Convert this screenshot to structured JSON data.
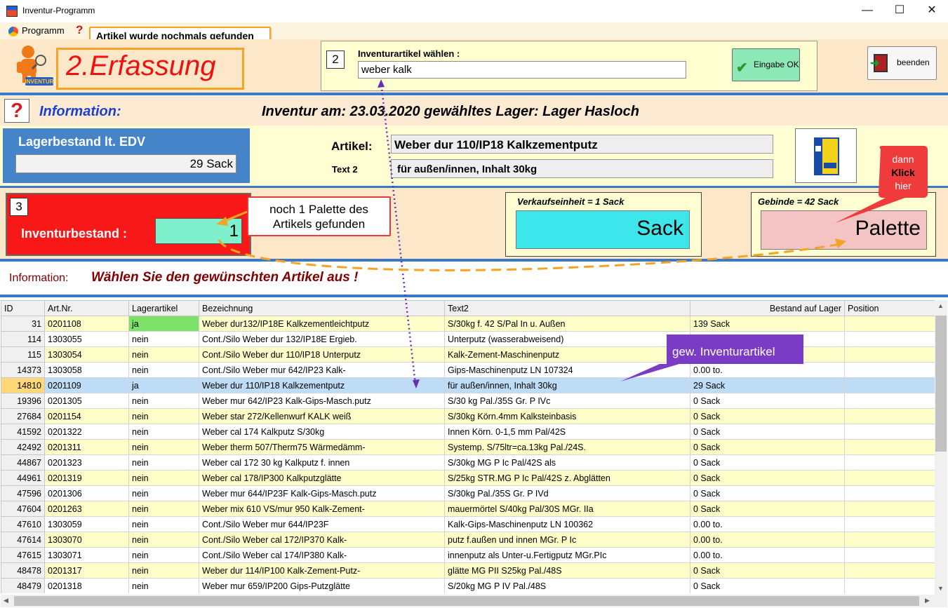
{
  "window": {
    "title": "Inventur-Programm",
    "controls": {
      "minimize": "—",
      "maximize": "☐",
      "close": "✕"
    }
  },
  "menu": {
    "programm": "Programm",
    "help": "?",
    "tooltip": "Artikel wurde nochmals gefunden"
  },
  "header": {
    "mode_title": "2.Erfassung",
    "mascot_caption": "INVENTUR",
    "step_number": "2",
    "select_label": "Inventurartikel wählen :",
    "select_value": "weber kalk",
    "ok_label": "Eingabe OK",
    "exit_label": "beenden"
  },
  "info": {
    "help": "?",
    "label": "Information:",
    "inventur_text": "Inventur am: 23.03.2020  gewähltes Lager:  Lager Hasloch"
  },
  "stock": {
    "title": "Lagerbestand lt. EDV",
    "value": "29  Sack"
  },
  "article": {
    "label": "Artikel:",
    "value": "Weber dur 110/IP18  Kalkzementputz",
    "text2_label": "Text 2",
    "text2_value": "für außen/innen, Inhalt 30kg"
  },
  "inventory": {
    "step_number": "3",
    "label": "Inventurbestand :",
    "value": "1",
    "callout": "noch 1  Palette des Artikels gefunden"
  },
  "units": {
    "ve_label": "Verkaufseinheit = 1 Sack",
    "sack_button": "Sack",
    "gebinde_label": "Gebinde = 42 Sack",
    "palette_button": "Palette",
    "hint_line1": "dann",
    "hint_line2": "Klick",
    "hint_line3": "hier"
  },
  "info2": {
    "label": "Information:",
    "message": "Wählen Sie den gewünschten Artikel aus !"
  },
  "grid": {
    "columns": [
      "ID",
      "Art.Nr.",
      "Lagerartikel",
      "Bezeichnung",
      "Text2",
      "Bestand auf Lager",
      "Position"
    ],
    "rows": [
      [
        "31",
        "0201108",
        "ja",
        "Weber dur132/IP18E Kalkzementleichtputz",
        "S/30kg f. 42 S/Pal In u. Außen",
        "139  Sack",
        ""
      ],
      [
        "114",
        "1303055",
        "nein",
        "Cont./Silo Weber dur 132/IP18E Ergieb.",
        "Unterputz  (wasserabweisend)",
        "",
        ""
      ],
      [
        "115",
        "1303054",
        "nein",
        "Cont./Silo Weber dur 110/IP18 Unterputz",
        "Kalk-Zement-Maschinenputz",
        "",
        ""
      ],
      [
        "14373",
        "1303058",
        "nein",
        "Cont./Silo Weber mur 642/IP23 Kalk-",
        "Gips-Maschinenputz LN 107324",
        "   0.00  to.",
        ""
      ],
      [
        "14810",
        "0201109",
        "ja",
        "Weber dur 110/IP18  Kalkzementputz",
        " für außen/innen, Inhalt 30kg",
        "29  Sack",
        ""
      ],
      [
        "19396",
        "0201305",
        "nein",
        "Weber mur 642/IP23 Kalk-Gips-Masch.putz",
        "S/30 kg  Pal./35S Gr. P IVc",
        "0  Sack",
        ""
      ],
      [
        "27684",
        "0201154",
        "nein",
        "Weber star 272/Kellenwurf KALK weiß",
        "S/30kg  Körn.4mm Kalksteinbasis",
        "0  Sack",
        ""
      ],
      [
        "41592",
        "0201322",
        "nein",
        "Weber cal 174 Kalkputz S/30kg",
        "Innen Körn. 0-1,5 mm Pal/42S",
        "0  Sack",
        ""
      ],
      [
        "42492",
        "0201311",
        "nein",
        "Weber therm 507/Therm75  Wärmedämm-",
        "Systemp. S/75ltr=ca.13kg Pal./24S.",
        "0  Sack",
        ""
      ],
      [
        "44867",
        "0201323",
        "nein",
        "Weber cal 172 30 kg Kalkputz f. innen",
        "S/30kg  MG P Ic  Pal/42S als",
        "0  Sack",
        ""
      ],
      [
        "44961",
        "0201319",
        "nein",
        "Weber cal 178/IP300 Kalkputzglätte",
        "S/25kg STR.MG P Ic  Pal/42S z. Abglätten",
        "0  Sack",
        ""
      ],
      [
        "47596",
        "0201306",
        "nein",
        "Weber mur 644/IP23F Kalk-Gips-Masch.putz",
        " S/30kg  Pal./35S Gr. P IVd",
        "0  Sack",
        ""
      ],
      [
        "47604",
        "0201263",
        "nein",
        "Weber mix 610 VS/mur 950 Kalk-Zement-",
        "mauermörtel  S/40kg Pal/30S MGr. IIa",
        "0  Sack",
        ""
      ],
      [
        "47610",
        "1303059",
        "nein",
        "Cont./Silo Weber mur 644/IP23F",
        "Kalk-Gips-Maschinenputz LN 100362",
        "   0.00  to.",
        ""
      ],
      [
        "47614",
        "1303070",
        "nein",
        "Cont./Silo Weber cal 172/IP370 Kalk-",
        "putz f.außen und innen MGr. P Ic",
        "   0.00  to.",
        ""
      ],
      [
        "47615",
        "1303071",
        "nein",
        "Cont./Silo Weber cal 174/IP380 Kalk-",
        "innenputz als Unter-u.Fertigputz MGr.PIc",
        "   0.00  to.",
        ""
      ],
      [
        "48478",
        "0201317",
        "nein",
        "Weber dur 114/IP100 Kalk-Zement-Putz-",
        "glätte  MG PII S25kg  Pal./48S",
        "0  Sack",
        ""
      ],
      [
        "48479",
        "0201318",
        "nein",
        "Weber mur 659/IP200 Gips-Putzglätte",
        "S/20kg  MG P IV Pal./48S",
        "0  Sack",
        ""
      ]
    ],
    "selected_row_id": "14810",
    "annotation": "gew. Inventurartikel"
  },
  "colors": {
    "header_bg": "#fce8c8",
    "accent_blue": "#3a78c8",
    "inventur_red": "#f81818",
    "sack_cyan": "#3de6ea",
    "palette_pink": "#f4c4c4",
    "selected_row": "#bfdcf6",
    "alt_row": "#fefec8",
    "annotation_purple": "#7a3cc4",
    "annotation_orange": "#f3a425"
  },
  "icons": {
    "app": "app-icon",
    "programm": "color-wheel-icon",
    "help": "question-mark-icon",
    "mascot": "inventory-mascot-icon",
    "ok": "checkmark-icon",
    "exit": "door-exit-icon",
    "product": "product-bag-icon"
  }
}
